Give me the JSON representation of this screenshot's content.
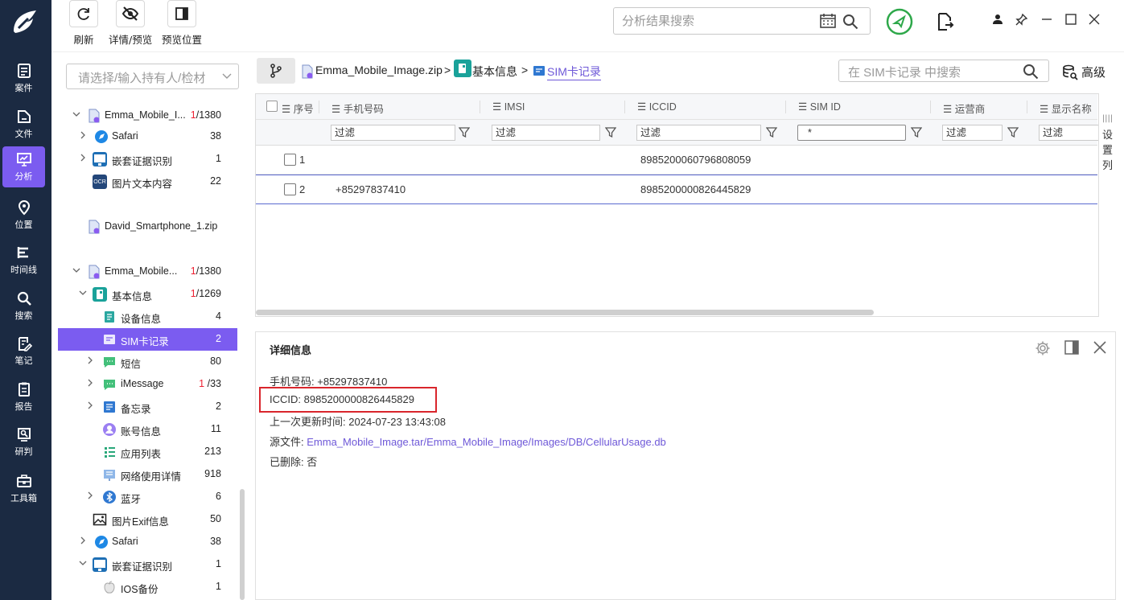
{
  "nav": {
    "items": [
      {
        "label": "案件",
        "icon": "case-icon"
      },
      {
        "label": "文件",
        "icon": "file-icon"
      },
      {
        "label": "分析",
        "icon": "analysis-icon",
        "active": true
      },
      {
        "label": "位置",
        "icon": "location-icon"
      },
      {
        "label": "时间线",
        "icon": "timeline-icon"
      },
      {
        "label": "搜索",
        "icon": "search-icon"
      },
      {
        "label": "笔记",
        "icon": "note-icon"
      },
      {
        "label": "报告",
        "icon": "report-icon"
      },
      {
        "label": "研判",
        "icon": "judge-icon"
      },
      {
        "label": "工具箱",
        "icon": "toolbox-icon"
      }
    ]
  },
  "toolbar": {
    "refresh": "刷新",
    "detail_preview": "详情/预览",
    "preview_position": "预览位置"
  },
  "top_search": {
    "placeholder": "分析结果搜索"
  },
  "tree": {
    "select_placeholder": "请选择/输入持有人/检材",
    "nodes": [
      {
        "label": "Emma_Mobile_I...",
        "count_red": "1",
        "count": "/1380"
      },
      {
        "label": "Safari",
        "count": "38"
      },
      {
        "label": "嵌套证据识别",
        "count": "1"
      },
      {
        "label": "图片文本内容",
        "count": "22"
      },
      {
        "label": "David_Smartphone_1.zip",
        "count": ""
      },
      {
        "label": "Emma_Mobile...",
        "count_red": "1",
        "count": "/1380"
      },
      {
        "label": "基本信息",
        "count_red": "1",
        "count": "/1269"
      },
      {
        "label": "设备信息",
        "count": "4"
      },
      {
        "label": "SIM卡记录",
        "count": "2"
      },
      {
        "label": "短信",
        "count": "80"
      },
      {
        "label": "iMessage",
        "count_red": "1",
        "count": "/33"
      },
      {
        "label": "备忘录",
        "count": "2"
      },
      {
        "label": "账号信息",
        "count": "11"
      },
      {
        "label": "应用列表",
        "count": "213"
      },
      {
        "label": "网络使用详情",
        "count": "918"
      },
      {
        "label": "蓝牙",
        "count": "6"
      },
      {
        "label": "图片Exif信息",
        "count": "50"
      },
      {
        "label": "Safari",
        "count": "38"
      },
      {
        "label": "嵌套证据识别",
        "count": "1"
      },
      {
        "label": "IOS备份",
        "count": "1"
      }
    ]
  },
  "breadcrumb": {
    "root": "Emma_Mobile_Image.zip",
    "level1": "基本信息",
    "current": "SIM卡记录",
    "sep": ">"
  },
  "sim_search": {
    "placeholder": "在 SIM卡记录 中搜索",
    "advanced": "高级"
  },
  "grid": {
    "columns": [
      "序号",
      "手机号码",
      "IMSI",
      "ICCID",
      "SIM ID",
      "运营商",
      "显示名称"
    ],
    "filter_placeholder": "过滤",
    "sim_id_filter": "*",
    "rows": [
      {
        "index": "1",
        "phone": "",
        "imsi": "",
        "iccid": "8985200060796808059"
      },
      {
        "index": "2",
        "phone": "+85297837410",
        "imsi": "",
        "iccid": "8985200000826445829"
      }
    ],
    "column_settings": "设置列"
  },
  "detail": {
    "title": "详细信息",
    "phone_label": "手机号码:",
    "phone": "+85297837410",
    "iccid_label": "ICCID:",
    "iccid": "8985200000826445829",
    "updated_label": "上一次更新时间:",
    "updated": "2024-07-23 13:43:08",
    "source_label": "源文件:",
    "source": "Emma_Mobile_Image.tar/Emma_Mobile_Image/Images/DB/CellularUsage.db",
    "deleted_label": "已删除:",
    "deleted": "否"
  },
  "colors": {
    "nav_bg": "#1b2a42",
    "accent": "#7b5cf0",
    "link": "#6e58d8",
    "highlight": "#d9262c"
  }
}
